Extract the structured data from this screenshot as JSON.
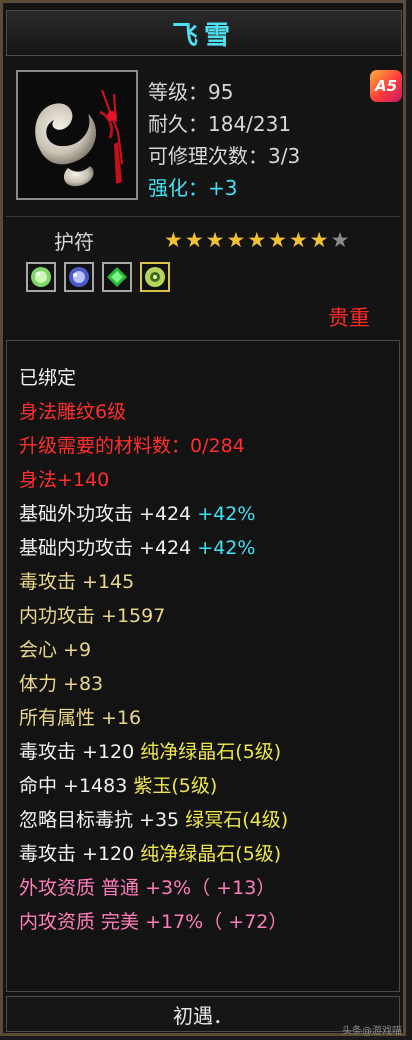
{
  "title": "飞雪",
  "level_label": "等级：",
  "level_value": "95",
  "durability_label": "耐久：",
  "durability_value": "184/231",
  "repair_label": "可修理次数：",
  "repair_value": "3/3",
  "enhance_label": "强化：",
  "enhance_value": "+3",
  "badge_text": "A5",
  "category": "护符",
  "stars_filled": 8,
  "stars_total": 9,
  "gem_slots": [
    "green-gem-icon",
    "blue-gem-icon",
    "emerald-gem-icon",
    "jade-gem-icon"
  ],
  "rarity": "贵重",
  "bound": "已绑定",
  "engraving": "身法雕纹6级",
  "upgrade_material_label": "升级需要的材料数：",
  "upgrade_material_value": "0/284",
  "agility_bonus": "身法+140",
  "base_ext_attack_label": "基础外功攻击 +424",
  "base_ext_attack_pct": "+42%",
  "base_int_attack_label": "基础内功攻击 +424",
  "base_int_attack_pct": "+42%",
  "poison_attack": "毒攻击 +145",
  "internal_attack": "内功攻击 +1597",
  "crit": "会心 +9",
  "stamina": "体力 +83",
  "all_attributes": "所有属性 +16",
  "gem1_stat": "毒攻击 +120",
  "gem1_name": "纯净绿晶石(5级)",
  "gem2_stat": "命中 +1483",
  "gem2_name": "紫玉(5级)",
  "gem3_stat": "忽略目标毒抗 +35",
  "gem3_name": "绿冥石(4级)",
  "gem4_stat": "毒攻击 +120",
  "gem4_name": "纯净绿晶石(5级)",
  "ext_aptitude": "外攻资质  普通 +3%（ +13）",
  "int_aptitude": "内攻资质  完美 +17%（ +72）",
  "footer": "初遇．",
  "watermark": "头条@游戏喵",
  "colors": {
    "title": "#4fe0f2",
    "rarity": "#ff2a2a",
    "star_filled": "#f3c234",
    "star_empty": "#8a8a8a"
  }
}
